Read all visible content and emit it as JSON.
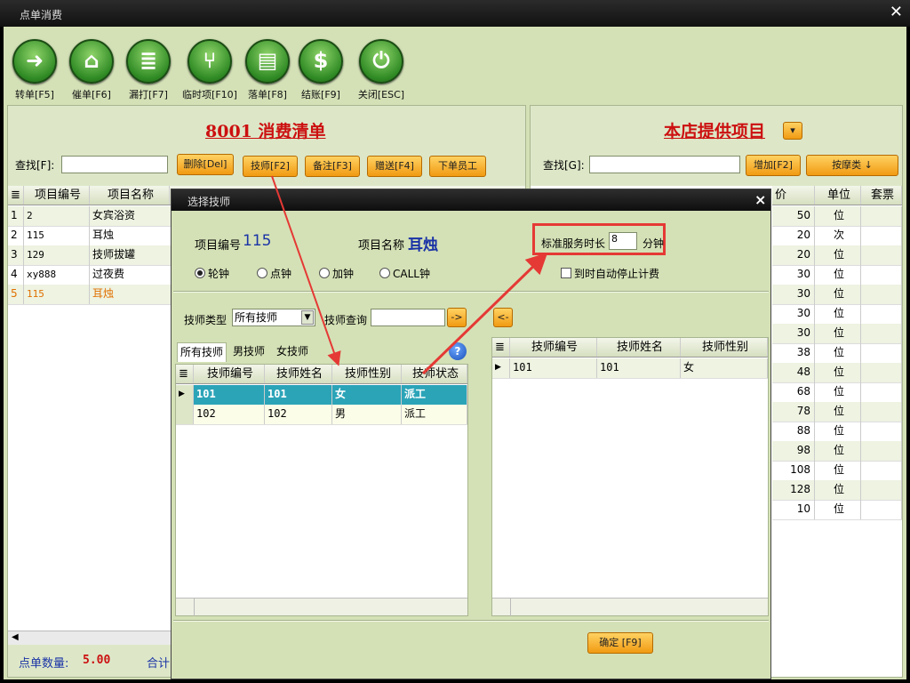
{
  "window": {
    "title": "点单消费",
    "close": "✕"
  },
  "toolbar": [
    {
      "label": "转单[F5]",
      "icon": "arrow-forward-icon",
      "glyph": "➜"
    },
    {
      "label": "催单[F6]",
      "icon": "bank-icon",
      "glyph": "⌂"
    },
    {
      "label": "漏打[F7]",
      "icon": "document-icon",
      "glyph": "≣"
    },
    {
      "label": "临时项[F10]",
      "icon": "utensils-icon",
      "glyph": "⑂"
    },
    {
      "label": "落单[F8]",
      "icon": "tray-icon",
      "glyph": "▤"
    },
    {
      "label": "结账[F9]",
      "icon": "dollar-icon",
      "glyph": "$"
    },
    {
      "label": "关闭[ESC]",
      "icon": "power-icon",
      "glyph": "⏻"
    }
  ],
  "left_panel": {
    "title": "8001 消费清单",
    "search_label": "查找[F]:",
    "search_value": "",
    "buttons": [
      "删除[Del]",
      "技师[F2]",
      "备注[F3]",
      "赠送[F4]",
      "下单员工"
    ],
    "columns": [
      "项目编号",
      "项目名称"
    ],
    "rows": [
      {
        "n": "1",
        "code": "2",
        "name": "女宾浴资"
      },
      {
        "n": "2",
        "code": "115",
        "name": "耳烛"
      },
      {
        "n": "3",
        "code": "129",
        "name": "技师拔罐"
      },
      {
        "n": "4",
        "code": "xy888",
        "name": "过夜费"
      },
      {
        "n": "5",
        "code": "115",
        "name": "耳烛"
      }
    ],
    "footer_count_label": "点单数量:",
    "footer_count_value": "5.00",
    "footer_total_label": "合计"
  },
  "right_panel": {
    "title": "本店提供项目",
    "search_label": "查找[G]:",
    "search_value": "",
    "add_button": "增加[F2]",
    "category_button": "按摩类 ↓",
    "columns": [
      "价",
      "单位",
      "套票"
    ],
    "rows": [
      {
        "price": "50",
        "unit": "位"
      },
      {
        "price": "20",
        "unit": "次"
      },
      {
        "price": "20",
        "unit": "位"
      },
      {
        "price": "30",
        "unit": "位"
      },
      {
        "price": "30",
        "unit": "位"
      },
      {
        "price": "30",
        "unit": "位"
      },
      {
        "price": "30",
        "unit": "位"
      },
      {
        "price": "38",
        "unit": "位"
      },
      {
        "price": "48",
        "unit": "位"
      },
      {
        "price": "68",
        "unit": "位"
      },
      {
        "price": "78",
        "unit": "位"
      },
      {
        "price": "88",
        "unit": "位"
      },
      {
        "price": "98",
        "unit": "位"
      },
      {
        "price": "108",
        "unit": "位"
      },
      {
        "price": "128",
        "unit": "位"
      },
      {
        "price": "10",
        "unit": "位"
      }
    ]
  },
  "dialog": {
    "title": "选择技师",
    "close": "×",
    "item_code_label": "项目编号",
    "item_code_value": "115",
    "item_name_label": "项目名称",
    "item_name_value": "耳烛",
    "duration_label": "标准服务时长",
    "duration_value": "8",
    "duration_unit": "分钟",
    "radios": [
      "轮钟",
      "点钟",
      "加钟",
      "CALL钟"
    ],
    "auto_stop_label": "到时自动停止计费",
    "tech_type_label": "技师类型",
    "tech_type_value": "所有技师",
    "tech_query_label": "技师查询",
    "tech_query_value": "",
    "go_right": "->",
    "go_left": "<-",
    "tabs": [
      "所有技师",
      "男技师",
      "女技师"
    ],
    "help": "?",
    "left_columns": [
      "技师编号",
      "技师姓名",
      "技师性别",
      "技师状态"
    ],
    "left_rows": [
      {
        "code": "101",
        "name": "101",
        "gender": "女",
        "status": "派工"
      },
      {
        "code": "102",
        "name": "102",
        "gender": "男",
        "status": "派工"
      }
    ],
    "right_columns": [
      "技师编号",
      "技师姓名",
      "技师性别"
    ],
    "right_rows": [
      {
        "code": "101",
        "name": "101",
        "gender": "女"
      }
    ],
    "confirm": "确定 [F9]"
  },
  "colors": {
    "accent": "#cc1010",
    "highlight_row": "#2ba4b8",
    "annotation": "#e53935"
  }
}
